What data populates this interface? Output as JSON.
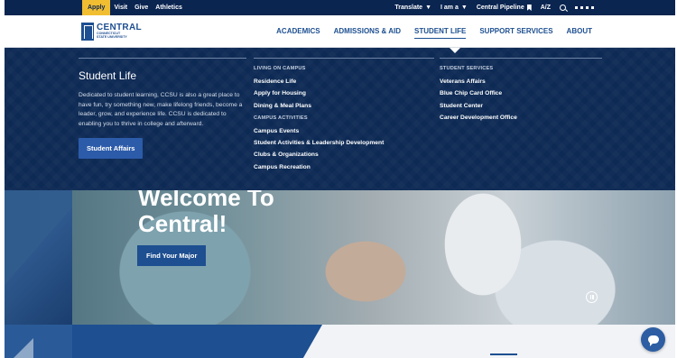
{
  "utility_bar": {
    "links": [
      "Apply",
      "Visit",
      "Give",
      "Athletics"
    ],
    "translate": "Translate",
    "i_am_a": "I am a",
    "central_pipeline": "Central Pipeline",
    "az": "A/Z"
  },
  "logo": {
    "name": "CENTRAL",
    "line1": "CONNECTICUT",
    "line2": "STATE UNIVERSITY"
  },
  "nav": {
    "items": [
      "ACADEMICS",
      "ADMISSIONS & AID",
      "STUDENT LIFE",
      "SUPPORT SERVICES",
      "ABOUT"
    ],
    "active": "STUDENT LIFE"
  },
  "mega_menu": {
    "title": "Student Life",
    "description": "Dedicated to student learning, CCSU is also a great place to have fun, try something new, make lifelong friends, become a leader, grow, and experience life. CCSU is dedicated to enabling you to thrive in college and afterward.",
    "button": "Student Affairs",
    "living_heading": "LIVING ON CAMPUS",
    "living_links": [
      "Residence Life",
      "Apply for Housing",
      "Dining & Meal Plans"
    ],
    "activities_heading": "CAMPUS ACTIVITIES",
    "activities_links": [
      "Campus Events",
      "Student Activities & Leadership Development",
      "Clubs & Organizations",
      "Campus Recreation"
    ],
    "services_heading": "STUDENT SERVICES",
    "services_links": [
      "Veterans Affairs",
      "Blue Chip Card Office",
      "Student Center",
      "Career Development Office"
    ]
  },
  "hero": {
    "title_line1": "Welcome To",
    "title_line2": "Central!",
    "button": "Find Your Major"
  },
  "colors": {
    "navy": "#0b2551",
    "brand_blue": "#1d4f91",
    "apply_yellow": "#f1be32"
  },
  "icons": {
    "bookmark": "bookmark-icon",
    "search": "search-icon",
    "grid": "grid-menu-icon",
    "pause": "pause-icon",
    "chat": "chat-icon"
  }
}
